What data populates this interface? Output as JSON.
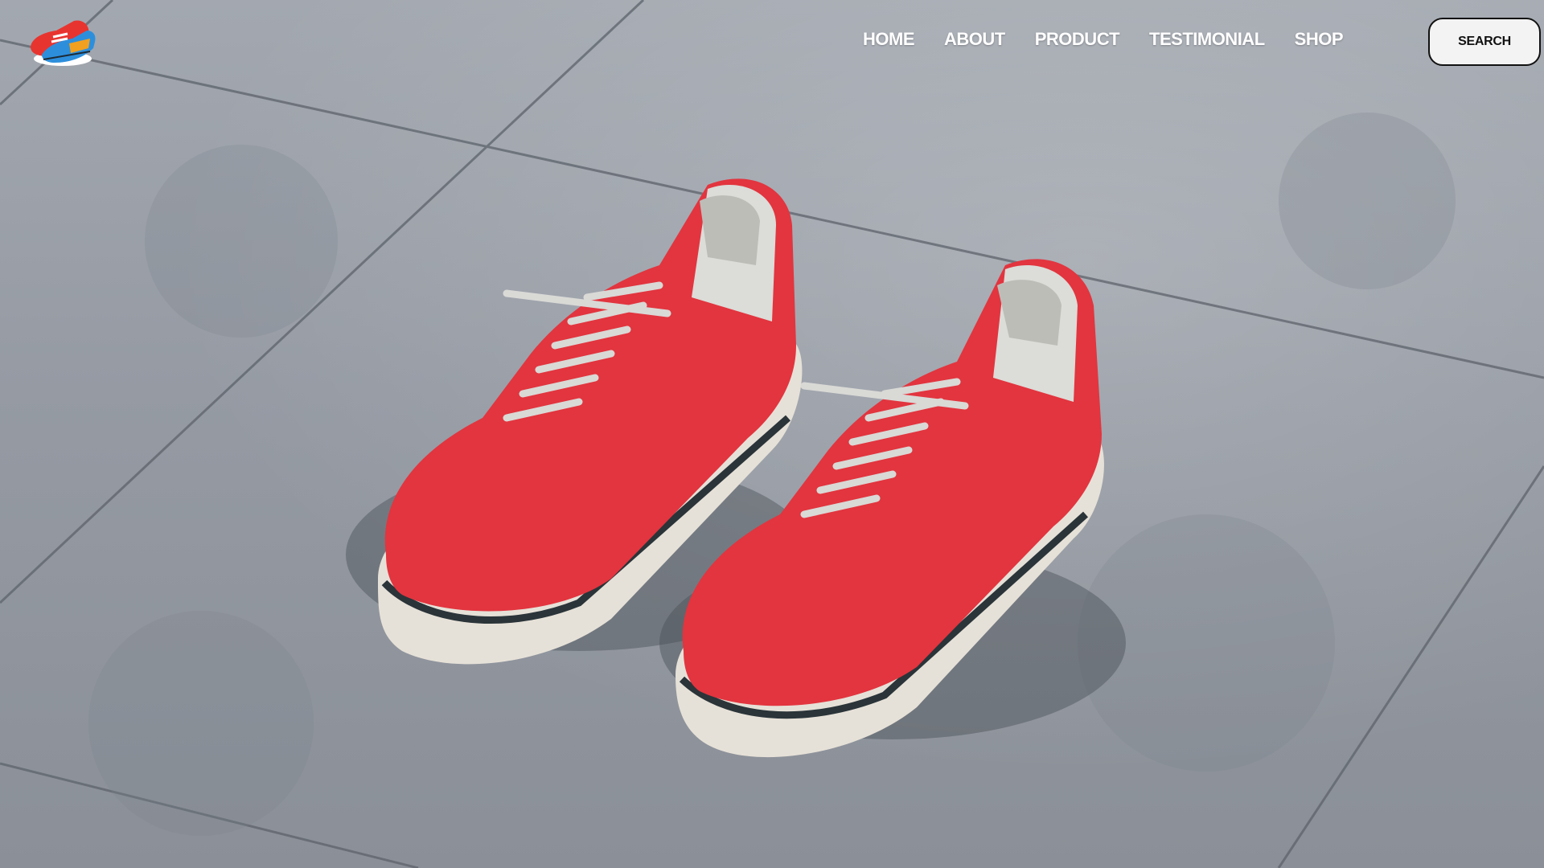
{
  "brand": {
    "logo_icon": "sneakers-logo-icon"
  },
  "nav": {
    "items": [
      {
        "label": "HOME"
      },
      {
        "label": "ABOUT"
      },
      {
        "label": "PRODUCT"
      },
      {
        "label": "TESTIMONIAL"
      },
      {
        "label": "SHOP"
      }
    ],
    "search_label": "SEARCH"
  },
  "hero": {
    "image": "red-sneakers-on-concrete-tiles",
    "shoe_color": "#e2353f",
    "sole_color": "#e6e1d8",
    "stripe_color": "#2a3439"
  }
}
